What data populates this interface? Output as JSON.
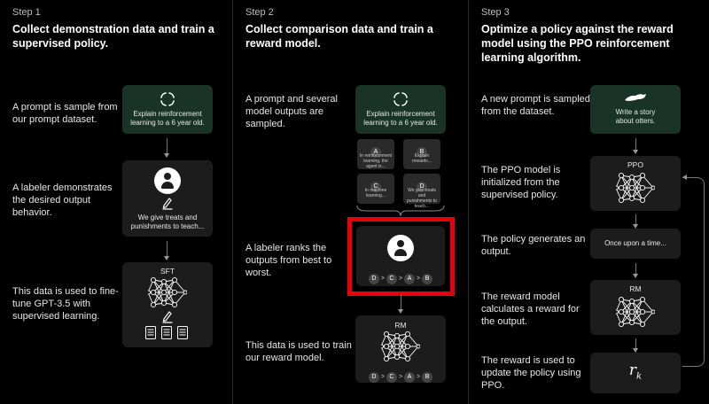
{
  "steps": [
    {
      "label": "Step 1",
      "heading": "Collect demonstration data and train a supervised policy.",
      "descriptions": [
        "A prompt is sample from our prompt dataset.",
        "A labeler demonstrates the desired output behavior.",
        "This data is used to fine-tune GPT-3.5 with supervised learning."
      ],
      "prompt": "Explain reinforcement learning to a 6 year old.",
      "output": "We give treats and punishments to teach...",
      "model": "SFT"
    },
    {
      "label": "Step 2",
      "heading": "Collect comparison data and train a reward model.",
      "descriptions": [
        "A prompt and several model outputs are sampled.",
        "A labeler ranks the outputs from best to worst.",
        "This data is used to train our reward model."
      ],
      "prompt": "Explain reinforcement learning to a 6 year old.",
      "outputs": [
        {
          "letter": "A",
          "text": "In reinforcement learning, the agent is..."
        },
        {
          "letter": "B",
          "text": "Explain rewards..."
        },
        {
          "letter": "C",
          "text": "In machine learning..."
        },
        {
          "letter": "D",
          "text": "We give treats and punishments to teach..."
        }
      ],
      "ranking": [
        "D",
        "C",
        "A",
        "B"
      ],
      "ranking_separator": ">",
      "model": "RM"
    },
    {
      "label": "Step 3",
      "heading": "Optimize a policy against the reward model using the PPO reinforcement learning algorithm.",
      "descriptions": [
        "A new prompt is sampled from the dataset.",
        "The PPO model is initialized from the supervised policy.",
        "The policy generates an output.",
        "The reward model calculates a reward for the output.",
        "The reward is used to update the policy using PPO."
      ],
      "prompt": "Write a story about otters.",
      "policy_model": "PPO",
      "output": "Once upon a time...",
      "reward_model": "RM",
      "reward_symbol": "r",
      "reward_subscript": "k"
    }
  ],
  "colors": {
    "background": "#000000",
    "box": "#1c1c1c",
    "prompt_box": "#1a3327",
    "highlight": "#e8000d"
  }
}
